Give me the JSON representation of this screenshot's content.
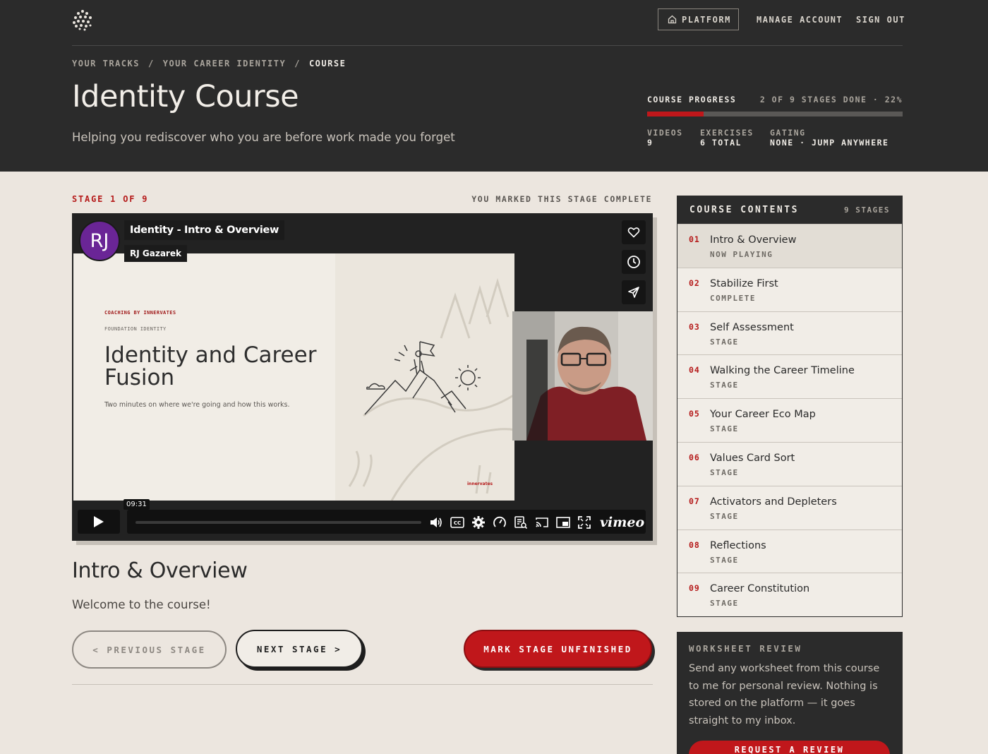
{
  "nav": {
    "platform": "PLATFORM",
    "manage": "MANAGE ACCOUNT",
    "signout": "SIGN OUT"
  },
  "breadcrumb": [
    "YOUR TRACKS",
    "/",
    "YOUR CAREER IDENTITY",
    "/",
    "COURSE"
  ],
  "hero": {
    "title": "Identity Course",
    "subtitle": "Helping you rediscover who you are before work made you forget"
  },
  "progress": {
    "label": "COURSE PROGRESS",
    "summary": "2 OF 9 STAGES DONE · 22%",
    "percent": 22,
    "stats": [
      {
        "k": "VIDEOS",
        "v": "9"
      },
      {
        "k": "EXERCISES",
        "v": "6 TOTAL"
      },
      {
        "k": "GATING",
        "v": "NONE · JUMP ANYWHERE"
      }
    ]
  },
  "stage": {
    "label": "STAGE 1 OF 9",
    "complete_note": "YOU MARKED THIS STAGE COMPLETE",
    "heading": "Intro & Overview",
    "description": "Welcome to the course!"
  },
  "video": {
    "avatar_initials": "RJ",
    "title": "Identity - Intro & Overview",
    "author": "RJ Gazarek",
    "time": "09:31",
    "brand": "vimeo",
    "slide": {
      "kicker": "COACHING BY INNERVATES",
      "kicker2": "FOUNDATION IDENTITY",
      "heading": "Identity and Career Fusion",
      "sub": "Two minutes on where we're going and how this works.",
      "brand": "innervates"
    }
  },
  "buttons": {
    "prev": "< PREVIOUS STAGE",
    "next": "NEXT STAGE >",
    "mark": "MARK STAGE UNFINISHED"
  },
  "toc": {
    "title": "COURSE CONTENTS",
    "count": "9 STAGES",
    "items": [
      {
        "num": "01",
        "name": "Intro & Overview",
        "status": "NOW PLAYING"
      },
      {
        "num": "02",
        "name": "Stabilize First",
        "status": "COMPLETE"
      },
      {
        "num": "03",
        "name": "Self Assessment",
        "status": "STAGE"
      },
      {
        "num": "04",
        "name": "Walking the Career Timeline",
        "status": "STAGE"
      },
      {
        "num": "05",
        "name": "Your Career Eco Map",
        "status": "STAGE"
      },
      {
        "num": "06",
        "name": "Values Card Sort",
        "status": "STAGE"
      },
      {
        "num": "07",
        "name": "Activators and Depleters",
        "status": "STAGE"
      },
      {
        "num": "08",
        "name": "Reflections",
        "status": "STAGE"
      },
      {
        "num": "09",
        "name": "Career Constitution",
        "status": "STAGE"
      }
    ]
  },
  "worksheet": {
    "heading": "WORKSHEET REVIEW",
    "body": "Send any worksheet from this course to me for personal review. Nothing is stored on the platform — it goes straight to my inbox.",
    "button": "REQUEST A REVIEW"
  },
  "colors": {
    "accent": "#c0171b",
    "dark": "#2b2b2b",
    "paper": "#ece6df"
  }
}
